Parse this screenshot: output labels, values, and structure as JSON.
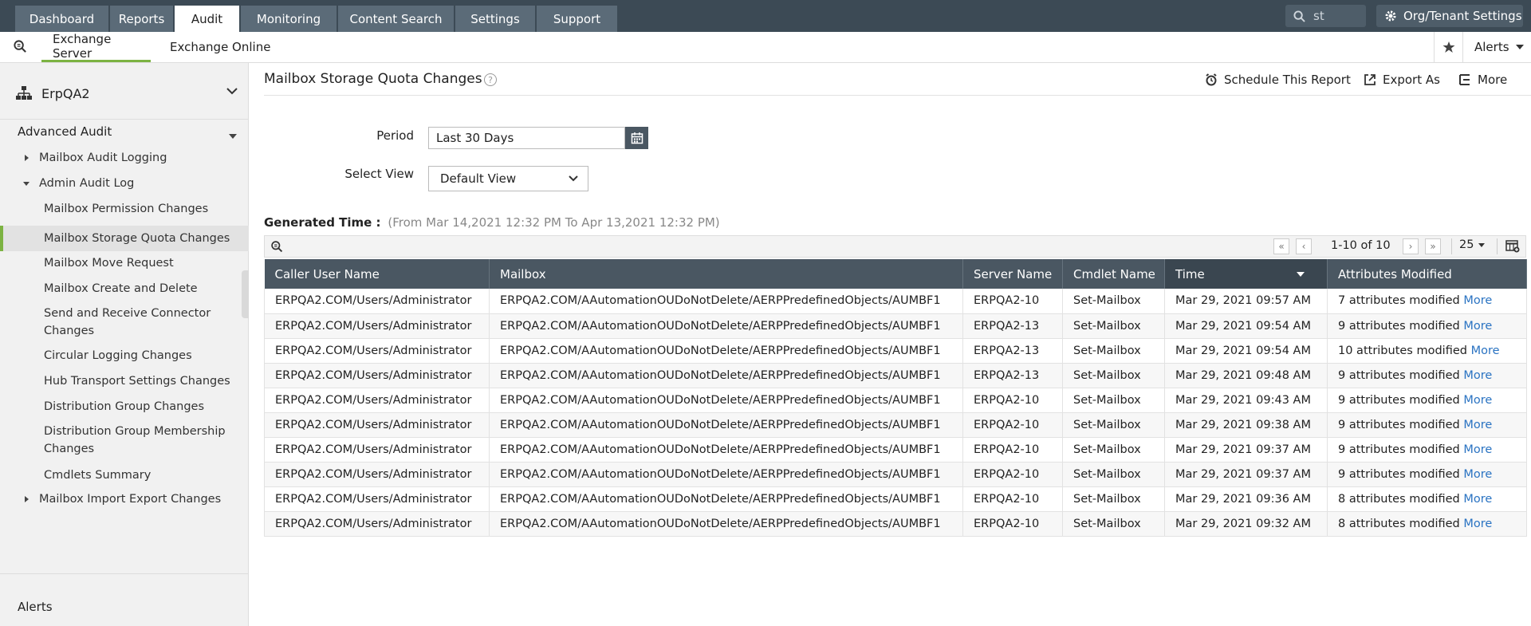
{
  "topnav": {
    "tabs": [
      {
        "label": "Dashboard",
        "active": false
      },
      {
        "label": "Reports",
        "active": false
      },
      {
        "label": "Audit",
        "active": true
      },
      {
        "label": "Monitoring",
        "active": false
      },
      {
        "label": "Content Search",
        "active": false
      },
      {
        "label": "Settings",
        "active": false
      },
      {
        "label": "Support",
        "active": false
      }
    ],
    "search_value": "st",
    "org_settings_label": "Org/Tenant Settings"
  },
  "subnav": {
    "tabs": [
      {
        "label": "Exchange Server",
        "active": true
      },
      {
        "label": "Exchange Online",
        "active": false
      }
    ],
    "alerts_label": "Alerts"
  },
  "sidebar": {
    "domain": "ErpQA2",
    "section_title": "Advanced Audit",
    "groups": [
      {
        "label": "Mailbox Audit Logging",
        "expanded": false
      },
      {
        "label": "Admin Audit Log",
        "expanded": true
      },
      {
        "label": "Mailbox Import Export Changes",
        "expanded": false
      }
    ],
    "items": [
      "Mailbox Permission Changes",
      "Mailbox Storage Quota Changes",
      "Mailbox Move Request",
      "Mailbox Create and Delete",
      "Send and Receive Connector Changes",
      "Circular Logging Changes",
      "Hub Transport Settings Changes",
      "Distribution Group Changes",
      "Distribution Group Membership Changes",
      "Cmdlets Summary"
    ],
    "active_item": "Mailbox Storage Quota Changes",
    "alerts_label": "Alerts"
  },
  "report": {
    "title": "Mailbox Storage Quota Changes",
    "actions": {
      "schedule": "Schedule This Report",
      "export": "Export As",
      "more": "More"
    },
    "period_label": "Period",
    "period_value": "Last 30 Days",
    "view_label": "Select View",
    "view_value": "Default View",
    "generated_label": "Generated Time :",
    "generated_value": "(From Mar 14,2021 12:32 PM To Apr 13,2021 12:32 PM)",
    "pagination": {
      "range": "1-10 of 10",
      "page_size": "25"
    },
    "columns": [
      "Caller User Name",
      "Mailbox",
      "Server Name",
      "Cmdlet Name",
      "Time",
      "Attributes Modified"
    ],
    "sorted_column": "Time",
    "more_link": "More",
    "rows": [
      [
        "ERPQA2.COM/Users/Administrator",
        "ERPQA2.COM/AAutomationOUDoNotDelete/AERPPredefinedObjects/AUMBF1",
        "ERPQA2-10",
        "Set-Mailbox",
        "Mar 29, 2021 09:57 AM",
        "7 attributes modified"
      ],
      [
        "ERPQA2.COM/Users/Administrator",
        "ERPQA2.COM/AAutomationOUDoNotDelete/AERPPredefinedObjects/AUMBF1",
        "ERPQA2-13",
        "Set-Mailbox",
        "Mar 29, 2021 09:54 AM",
        "9 attributes modified"
      ],
      [
        "ERPQA2.COM/Users/Administrator",
        "ERPQA2.COM/AAutomationOUDoNotDelete/AERPPredefinedObjects/AUMBF1",
        "ERPQA2-13",
        "Set-Mailbox",
        "Mar 29, 2021 09:54 AM",
        "10 attributes modified"
      ],
      [
        "ERPQA2.COM/Users/Administrator",
        "ERPQA2.COM/AAutomationOUDoNotDelete/AERPPredefinedObjects/AUMBF1",
        "ERPQA2-13",
        "Set-Mailbox",
        "Mar 29, 2021 09:48 AM",
        "9 attributes modified"
      ],
      [
        "ERPQA2.COM/Users/Administrator",
        "ERPQA2.COM/AAutomationOUDoNotDelete/AERPPredefinedObjects/AUMBF1",
        "ERPQA2-10",
        "Set-Mailbox",
        "Mar 29, 2021 09:43 AM",
        "9 attributes modified"
      ],
      [
        "ERPQA2.COM/Users/Administrator",
        "ERPQA2.COM/AAutomationOUDoNotDelete/AERPPredefinedObjects/AUMBF1",
        "ERPQA2-10",
        "Set-Mailbox",
        "Mar 29, 2021 09:38 AM",
        "9 attributes modified"
      ],
      [
        "ERPQA2.COM/Users/Administrator",
        "ERPQA2.COM/AAutomationOUDoNotDelete/AERPPredefinedObjects/AUMBF1",
        "ERPQA2-10",
        "Set-Mailbox",
        "Mar 29, 2021 09:37 AM",
        "9 attributes modified"
      ],
      [
        "ERPQA2.COM/Users/Administrator",
        "ERPQA2.COM/AAutomationOUDoNotDelete/AERPPredefinedObjects/AUMBF1",
        "ERPQA2-10",
        "Set-Mailbox",
        "Mar 29, 2021 09:37 AM",
        "9 attributes modified"
      ],
      [
        "ERPQA2.COM/Users/Administrator",
        "ERPQA2.COM/AAutomationOUDoNotDelete/AERPPredefinedObjects/AUMBF1",
        "ERPQA2-10",
        "Set-Mailbox",
        "Mar 29, 2021 09:36 AM",
        "8 attributes modified"
      ],
      [
        "ERPQA2.COM/Users/Administrator",
        "ERPQA2.COM/AAutomationOUDoNotDelete/AERPPredefinedObjects/AUMBF1",
        "ERPQA2-10",
        "Set-Mailbox",
        "Mar 29, 2021 09:32 AM",
        "8 attributes modified"
      ]
    ]
  },
  "colors": {
    "nav_bg": "#3c4a55",
    "tab_bg": "#5b6b78",
    "accent_green": "#7cb342",
    "table_header": "#4a5762",
    "link_blue": "#2a73c2"
  },
  "icons": {
    "search": "search-icon",
    "gear": "gear-icon",
    "star": "star-icon",
    "org_tree": "org-tree-icon",
    "help": "help-icon",
    "schedule": "alarm-clock-icon",
    "export": "export-icon",
    "more": "more-icon",
    "calendar": "calendar-icon",
    "columns": "column-chooser-icon"
  }
}
